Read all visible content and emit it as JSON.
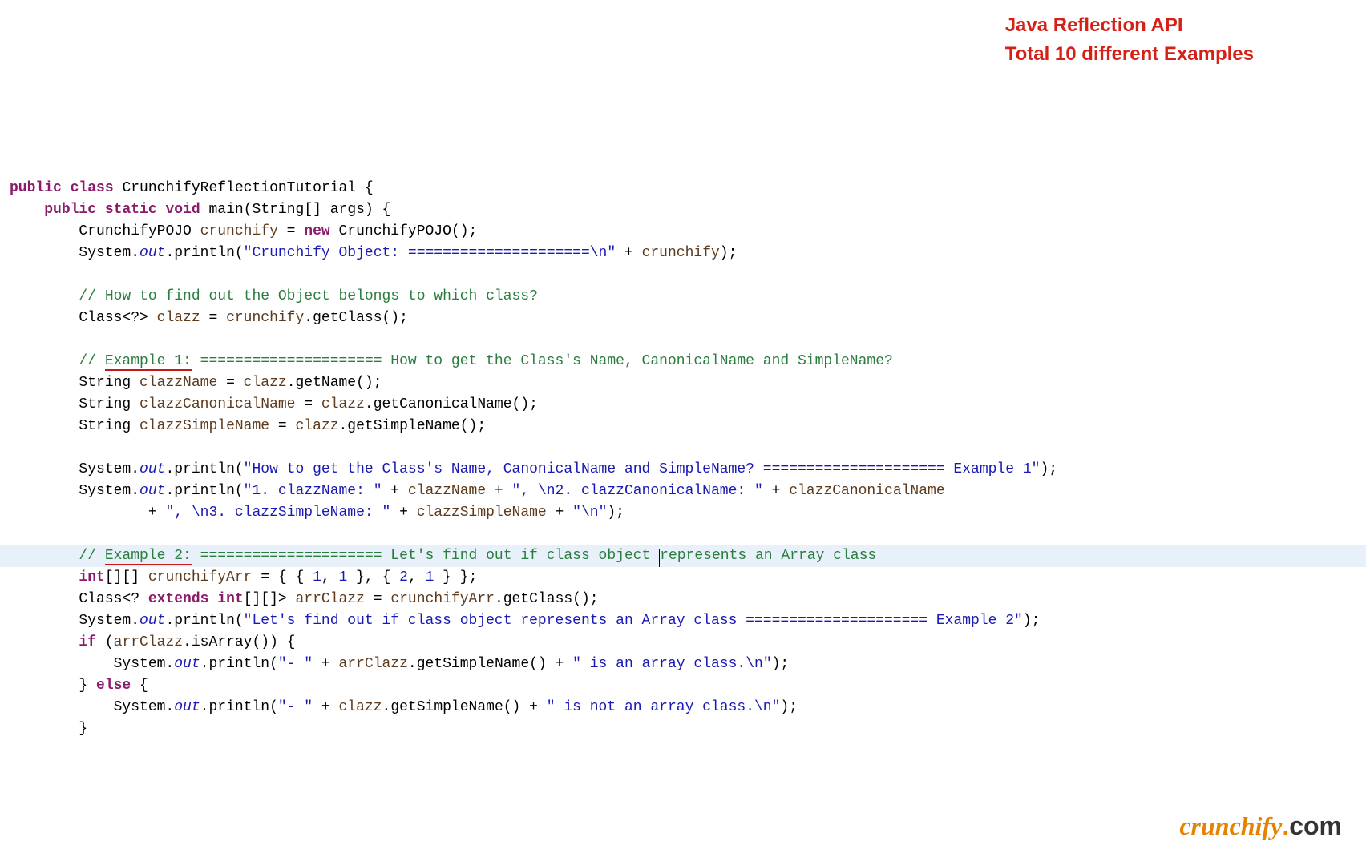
{
  "callout": {
    "line1": "Java Reflection API",
    "line2": "Total 10 different Examples"
  },
  "logo": {
    "brand": "crunchify",
    "dot": ".",
    "tld": "com"
  },
  "code": {
    "l1_kw1": "public",
    "l1_kw2": "class",
    "l1_class": "CrunchifyReflectionTutorial",
    "l1_brace": " {",
    "l2_kw1": "public",
    "l2_kw2": "static",
    "l2_kw3": "void",
    "l2_method": "main",
    "l2_params": "(String[] args) {",
    "l3_type": "CrunchifyPOJO ",
    "l3_var": "crunchify",
    "l3_op": " = ",
    "l3_kw": "new",
    "l3_ctor": " CrunchifyPOJO();",
    "l4_a": "System.",
    "l4_out": "out",
    "l4_b": ".println(",
    "l4_str": "\"Crunchify Object: =====================",
    "l4_esc": "\\n",
    "l4_strend": "\"",
    "l4_c": " + ",
    "l4_var": "crunchify",
    "l4_d": ");",
    "l6_cmt": "// How to find out the Object belongs to which class?",
    "l7_a": "Class<?> ",
    "l7_var": "clazz",
    "l7_op": " = ",
    "l7_var2": "crunchify",
    "l7_b": ".getClass();",
    "l9_a": "// ",
    "l9_u": "Example 1:",
    "l9_b": " ===================== How to get the Class's Name, CanonicalName and SimpleName?",
    "l10_a": "String ",
    "l10_var": "clazzName",
    "l10_op": " = ",
    "l10_var2": "clazz",
    "l10_b": ".getName();",
    "l11_a": "String ",
    "l11_var": "clazzCanonicalName",
    "l11_op": " = ",
    "l11_var2": "clazz",
    "l11_b": ".getCanonicalName();",
    "l12_a": "String ",
    "l12_var": "clazzSimpleName",
    "l12_op": " = ",
    "l12_var2": "clazz",
    "l12_b": ".getSimpleName();",
    "l14_a": "System.",
    "l14_out": "out",
    "l14_b": ".println(",
    "l14_str": "\"How to get the Class's Name, CanonicalName and SimpleName? ===================== Example 1\"",
    "l14_c": ");",
    "l15_a": "System.",
    "l15_out": "out",
    "l15_b": ".println(",
    "l15_str1": "\"1. clazzName: \"",
    "l15_c": " + ",
    "l15_var1": "clazzName",
    "l15_d": " + ",
    "l15_str2": "\", ",
    "l15_esc1": "\\n",
    "l15_str2b": "2. clazzCanonicalName: \"",
    "l15_e": " + ",
    "l15_var2": "clazzCanonicalName",
    "l16_a": "+ ",
    "l16_str1": "\", ",
    "l16_esc1": "\\n",
    "l16_str1b": "3. clazzSimpleName: \"",
    "l16_b": " + ",
    "l16_var1": "clazzSimpleName",
    "l16_c": " + ",
    "l16_str2": "\"",
    "l16_esc2": "\\n",
    "l16_str2b": "\"",
    "l16_d": ");",
    "l18_a": "// ",
    "l18_u": "Example 2:",
    "l18_b": " ===================== Let's find out if class object ",
    "l18_c": "represents an Array class",
    "l19_int": "int",
    "l19_a": "[][] ",
    "l19_var": "crunchifyArr",
    "l19_op": " = { { ",
    "l19_n1": "1",
    "l19_c1": ", ",
    "l19_n2": "1",
    "l19_c2": " }, { ",
    "l19_n3": "2",
    "l19_c3": ", ",
    "l19_n4": "1",
    "l19_c4": " } };",
    "l20_a": "Class<? ",
    "l20_kw": "extends",
    "l20_b": " ",
    "l20_int": "int",
    "l20_c": "[][]> ",
    "l20_var": "arrClazz",
    "l20_op": " = ",
    "l20_var2": "crunchifyArr",
    "l20_d": ".getClass();",
    "l21_a": "System.",
    "l21_out": "out",
    "l21_b": ".println(",
    "l21_str": "\"Let's find out if class object represents an Array class ===================== Example 2\"",
    "l21_c": ");",
    "l22_kw": "if",
    "l22_a": " (",
    "l22_var": "arrClazz",
    "l22_b": ".isArray()) {",
    "l23_a": "System.",
    "l23_out": "out",
    "l23_b": ".println(",
    "l23_str": "\"- \"",
    "l23_c": " + ",
    "l23_var": "arrClazz",
    "l23_d": ".getSimpleName() + ",
    "l23_str2": "\" is an array class.",
    "l23_esc": "\\n",
    "l23_str2b": "\"",
    "l23_e": ");",
    "l24_a": "} ",
    "l24_kw": "else",
    "l24_b": " {",
    "l25_a": "System.",
    "l25_out": "out",
    "l25_b": ".println(",
    "l25_str": "\"- \"",
    "l25_c": " + ",
    "l25_var": "clazz",
    "l25_d": ".getSimpleName() + ",
    "l25_str2": "\" is not an array class.",
    "l25_esc": "\\n",
    "l25_str2b": "\"",
    "l25_e": ");",
    "l26_a": "}"
  }
}
